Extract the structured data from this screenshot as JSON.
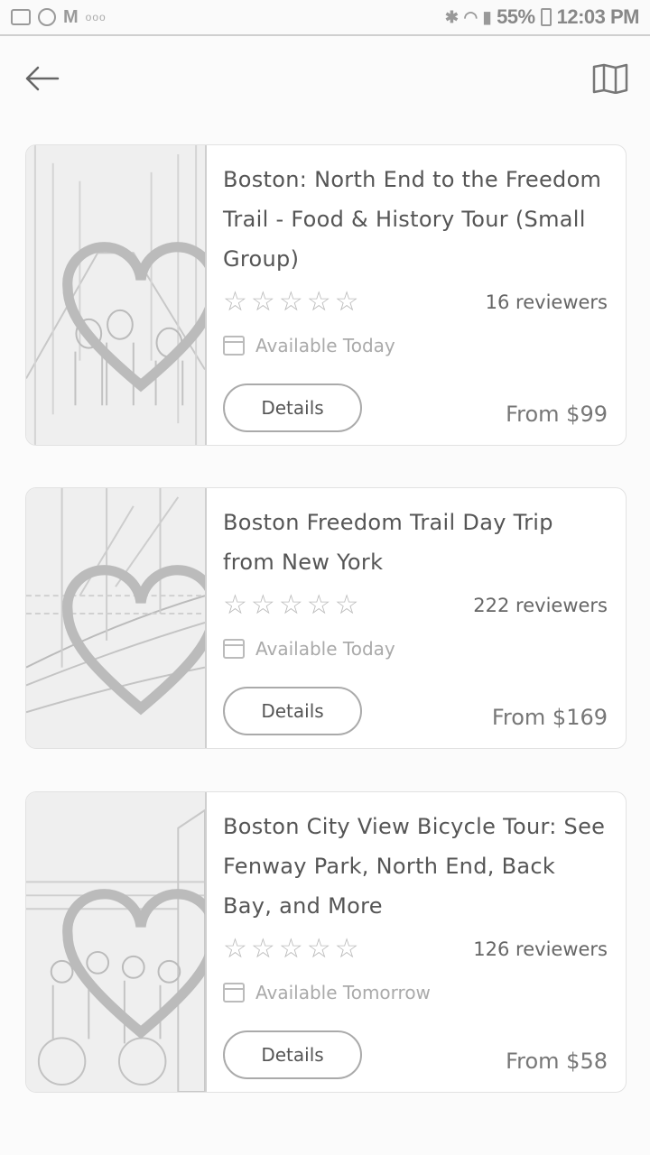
{
  "status_bar": {
    "left_icons": [
      "image-icon",
      "pinwheel-icon",
      "gmail-icon",
      "more-dots-icon"
    ],
    "gmail_letter": "M",
    "dots": "ooo",
    "bluetooth": "✱",
    "wifi": "◠",
    "signal": "▮",
    "battery": "55%",
    "time": "12:03 PM"
  },
  "appbar": {
    "back_icon": "back-arrow-icon",
    "map_icon": "map-icon"
  },
  "cards": [
    {
      "title": "Boston: North End to the Freedom Trail - Food & History Tour (Small Group)",
      "rating_stars": 5,
      "filled_stars": 0,
      "reviews": "16 reviewers",
      "availability": "Available Today",
      "details_label": "Details",
      "price": "From $99"
    },
    {
      "title": "Boston Freedom Trail Day Trip from New York",
      "rating_stars": 5,
      "filled_stars": 0,
      "reviews": "222 reviewers",
      "availability": "Available Today",
      "details_label": "Details",
      "price": "From $169"
    },
    {
      "title": "Boston City View Bicycle Tour: See Fenway Park, North End, Back Bay, and More",
      "rating_stars": 5,
      "filled_stars": 0,
      "reviews": "126 reviewers",
      "availability": "Available Tomorrow",
      "details_label": "Details",
      "price": "From $58"
    }
  ]
}
